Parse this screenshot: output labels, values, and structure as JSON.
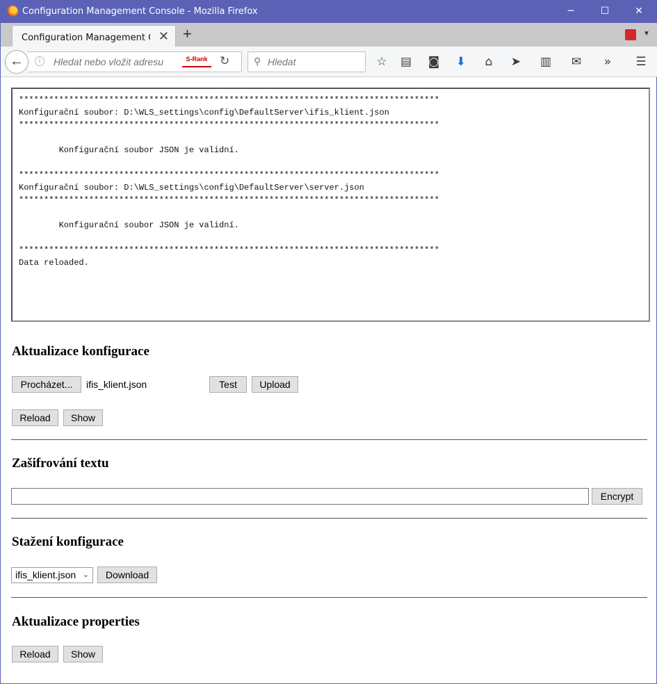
{
  "window": {
    "title": "Configuration Management Console - Mozilla Firefox",
    "minimize": "─",
    "maximize": "☐",
    "close": "✕"
  },
  "tabs": {
    "active_title": "Configuration Management C...",
    "close": "✕",
    "new_tab": "+"
  },
  "navbar": {
    "url_placeholder": "Hledat nebo vložit adresu",
    "srank": "S-Rank",
    "search_placeholder": "Hledat"
  },
  "console": {
    "lines": [
      "************************************************************************************",
      "Konfigurační soubor: D:\\WLS_settings\\config\\DefaultServer\\ifis_klient.json",
      "************************************************************************************",
      "",
      "        Konfigurační soubor JSON je validní.",
      "",
      "************************************************************************************",
      "Konfigurační soubor: D:\\WLS_settings\\config\\DefaultServer\\server.json",
      "************************************************************************************",
      "",
      "        Konfigurační soubor JSON je validní.",
      "",
      "************************************************************************************",
      "Data reloaded."
    ]
  },
  "config_update": {
    "heading": "Aktualizace konfigurace",
    "browse_label": "Procházet...",
    "selected_file": "ifis_klient.json",
    "test_label": "Test",
    "upload_label": "Upload",
    "reload_label": "Reload",
    "show_label": "Show"
  },
  "encryption": {
    "heading": "Zašifrování textu",
    "input_value": "",
    "encrypt_label": "Encrypt"
  },
  "download": {
    "heading": "Stažení konfigurace",
    "selected_option": "ifis_klient.json",
    "download_label": "Download"
  },
  "properties": {
    "heading": "Aktualizace properties",
    "reload_label": "Reload",
    "show_label": "Show"
  }
}
